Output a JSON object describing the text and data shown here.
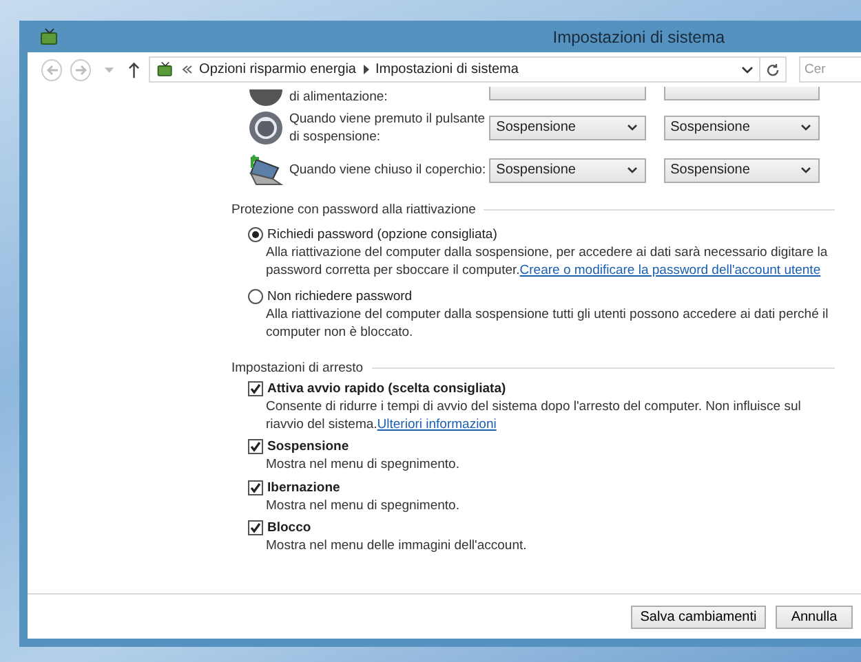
{
  "window": {
    "title": "Impostazioni di sistema"
  },
  "address_bar": {
    "breadcrumbs": [
      "Opzioni risparmio energia",
      "Impostazioni di sistema"
    ],
    "search_placeholder": "Cer"
  },
  "power_rows_cut": {
    "label": "di alimentazione:"
  },
  "power_rows": [
    {
      "kind": "button",
      "label": "Quando viene premuto il pulsante di sospensione:",
      "selects": [
        "Sospensione",
        "Sospensione"
      ]
    },
    {
      "kind": "lid",
      "label": "Quando viene chiuso il coperchio:",
      "selects": [
        "Sospensione",
        "Sospensione"
      ]
    }
  ],
  "password_section": {
    "title": "Protezione con password alla riattivazione",
    "options": [
      {
        "label": "Richiedi password (opzione consigliata)",
        "selected": true,
        "description": "Alla riattivazione del computer dalla sospensione, per accedere ai dati sarà necessario digitare la password corretta per sboccare il computer.",
        "link": "Creare o modificare la password dell'account utente"
      },
      {
        "label": "Non richiedere password",
        "selected": false,
        "description": "Alla riattivazione del computer dalla sospensione tutti gli utenti possono accedere ai dati perché il computer non è bloccato."
      }
    ]
  },
  "shutdown_section": {
    "title": "Impostazioni di arresto",
    "options": [
      {
        "label": "Attiva avvio rapido (scelta consigliata)",
        "checked": true,
        "description": "Consente di ridurre i tempi di avvio del sistema dopo l'arresto del computer. Non influisce sul riavvio del sistema.",
        "link": "Ulteriori informazioni"
      },
      {
        "label": "Sospensione",
        "checked": true,
        "description": "Mostra nel menu di spegnimento."
      },
      {
        "label": "Ibernazione",
        "checked": true,
        "description": "Mostra nel menu di spegnimento."
      },
      {
        "label": "Blocco",
        "checked": true,
        "description": "Mostra nel menu delle immagini dell'account."
      }
    ]
  },
  "buttons": [
    "Salva cambiamenti",
    "Annulla"
  ]
}
